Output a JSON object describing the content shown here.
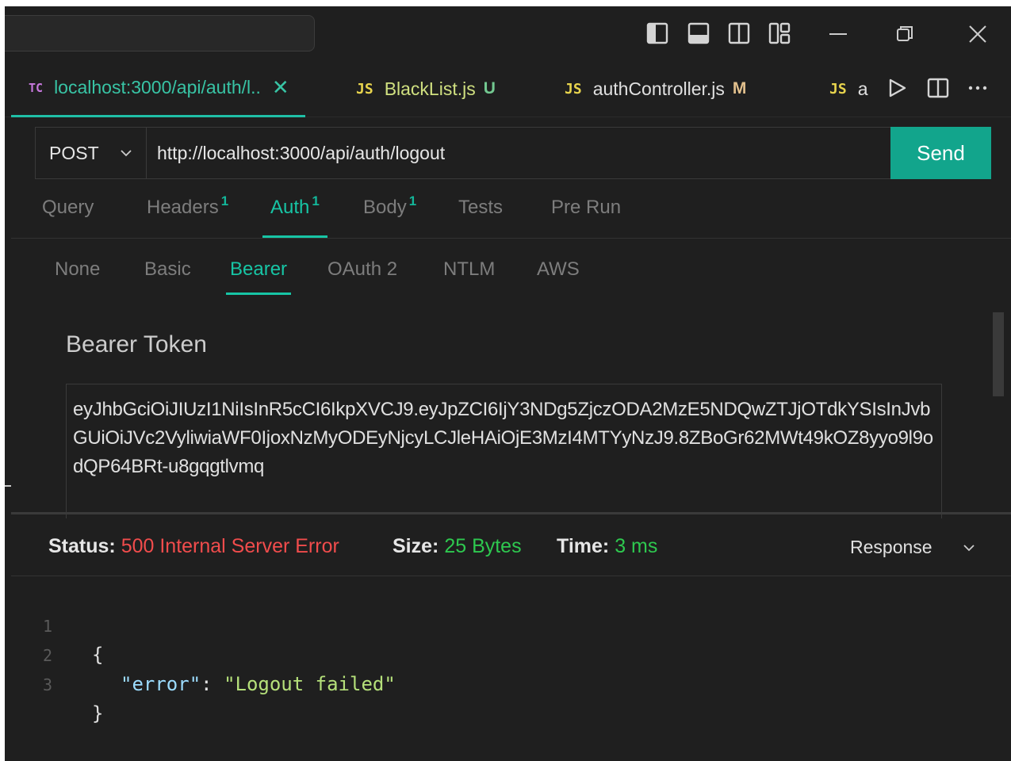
{
  "tabs": [
    {
      "badge": "TC",
      "label": "localhost:3000/api/auth/l..",
      "close": "✕"
    },
    {
      "badge": "JS",
      "label": "BlackList.js",
      "mark": "U"
    },
    {
      "badge": "JS",
      "label": "authController.js",
      "mark": "M"
    },
    {
      "badge": "JS",
      "label": "a"
    }
  ],
  "request": {
    "method": "POST",
    "url": "http://localhost:3000/api/auth/logout",
    "send_label": "Send"
  },
  "request_tabs": [
    {
      "label": "Query"
    },
    {
      "label": "Headers",
      "count": "1"
    },
    {
      "label": "Auth",
      "count": "1"
    },
    {
      "label": "Body",
      "count": "1"
    },
    {
      "label": "Tests"
    },
    {
      "label": "Pre Run"
    }
  ],
  "auth_tabs": [
    "None",
    "Basic",
    "Bearer",
    "OAuth 2",
    "NTLM",
    "AWS"
  ],
  "auth": {
    "token_label": "Bearer Token",
    "token": "eyJhbGciOiJIUzI1NiIsInR5cCI6IkpXVCJ9.eyJpZCI6IjY3NDg5ZjczODA2MzE5NDQwZTJjOTdkYSIsInJvbGUiOiJVc2VyliwiaWF0IjoxNzMyODEyNjcyLCJleHAiOjE3MzI4MTYyNzJ9.8ZBoGr62MWt49kOZ8yyo9l9odQP64BRt-u8gqgtlvmq"
  },
  "response": {
    "status_label": "Status:",
    "status_value": "500 Internal Server Error",
    "size_label": "Size:",
    "size_value": "25 Bytes",
    "time_label": "Time:",
    "time_value": "3 ms",
    "view_select": "Response",
    "lines": [
      {
        "num": "1",
        "open": "{"
      },
      {
        "num": "2",
        "key": "\"error\"",
        "sep": ": ",
        "value": "\"Logout failed\""
      },
      {
        "num": "3",
        "close": "}"
      }
    ]
  },
  "colors": {
    "accent": "#17c5a5",
    "send_bg": "#12a58c",
    "error": "#f14c4c",
    "success": "#2ec84f",
    "background": "#1f1f1f"
  },
  "icons": {
    "titlebar": [
      "toggle-primary-sidebar-icon",
      "toggle-panel-icon",
      "toggle-secondary-sidebar-icon",
      "customize-layout-icon"
    ],
    "window": [
      "minimize-icon",
      "restore-icon",
      "close-icon"
    ],
    "tab_actions": [
      "run-icon",
      "split-editor-icon",
      "more-actions-icon"
    ]
  }
}
